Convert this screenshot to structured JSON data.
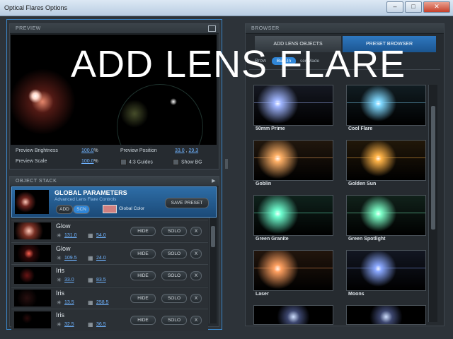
{
  "window": {
    "title": "Optical Flares Options",
    "min": "–",
    "max": "□",
    "close": "✕"
  },
  "overlay_title": "ADD LENS FLARE",
  "preview": {
    "header": "PREVIEW",
    "brightness_label": "Preview Brightness",
    "brightness_value": "100.0",
    "brightness_unit": "%",
    "scale_label": "Preview Scale",
    "scale_value": "100.0",
    "scale_unit": "%",
    "position_label": "Preview Position",
    "position_x": "33.0",
    "position_y": "29.3",
    "guides_label": "4:3 Guides",
    "showbg_label": "Show BG"
  },
  "object_stack": {
    "header": "OBJECT STACK",
    "global": {
      "title": "GLOBAL PARAMETERS",
      "subtitle": "Advanced Lens Flare Controls",
      "add": "ADD",
      "scn": "SCN",
      "color_label": "Global Color",
      "save_preset": "SAVE PRESET",
      "color": "#d08080"
    },
    "rows": [
      {
        "name": "Glow",
        "v1": "131.0",
        "v2": "54.0"
      },
      {
        "name": "Glow",
        "v1": "109.5",
        "v2": "24.0"
      },
      {
        "name": "Iris",
        "v1": "33.0",
        "v2": "83.5"
      },
      {
        "name": "Iris",
        "v1": "13.5",
        "v2": "258.5"
      },
      {
        "name": "Iris",
        "v1": "32.5",
        "v2": "36.5"
      }
    ],
    "hide": "HIDE",
    "solo": "SOLO",
    "x": "X"
  },
  "browser": {
    "header": "BROWSER",
    "tab_add": "ADD LENS OBJECTS",
    "tab_preset": "PRESET BROWSER",
    "filter_label": "Brow",
    "filter_built": "Built-In",
    "filter_user": "ser Made",
    "items": [
      {
        "name": "50mm Prime",
        "glow": "#9fb5ff"
      },
      {
        "name": "Cool Flare",
        "glow": "#7fd8ff"
      },
      {
        "name": "Goblin",
        "glow": "#ffb066"
      },
      {
        "name": "Golden Sun",
        "glow": "#ffb347"
      },
      {
        "name": "Green Granite",
        "glow": "#6fffd0"
      },
      {
        "name": "Green Spotlight",
        "glow": "#7dffc8"
      },
      {
        "name": "Laser",
        "glow": "#ffa060"
      },
      {
        "name": "Moons",
        "glow": "#8aa8ff"
      }
    ]
  }
}
